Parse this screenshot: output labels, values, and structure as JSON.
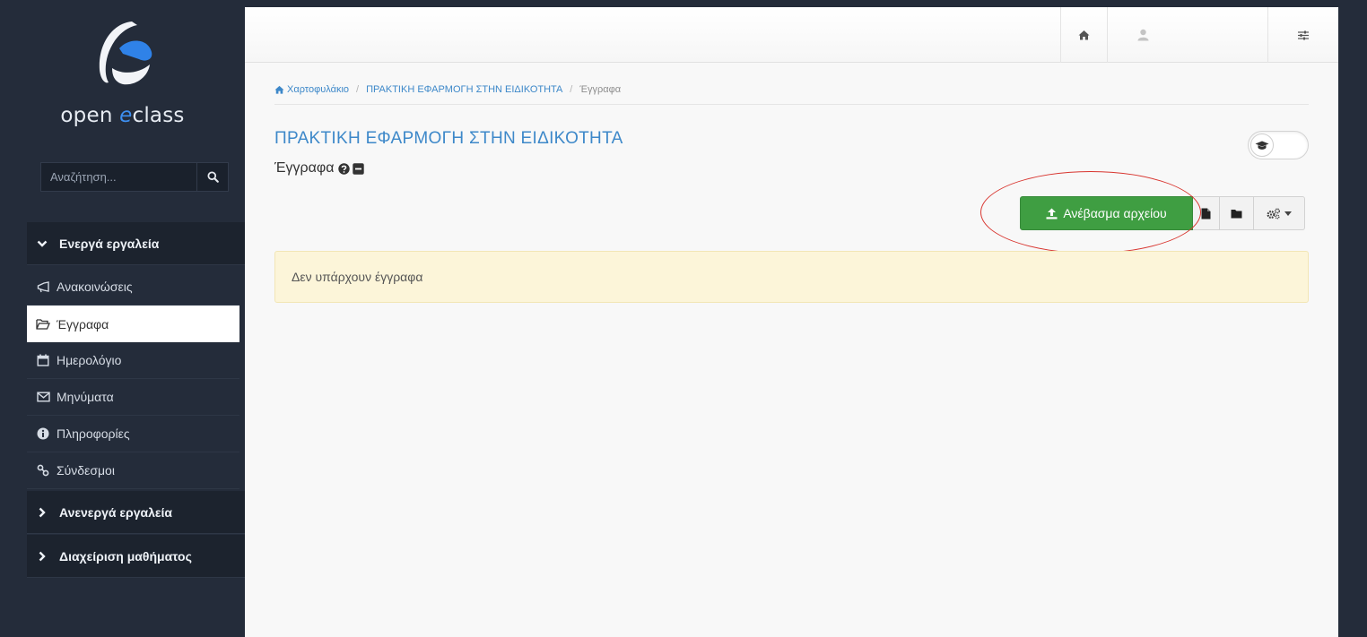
{
  "brand": {
    "name_prefix": "open ",
    "name_accent": "e",
    "name_suffix": "class",
    "accent_color": "#3d8ff0"
  },
  "sidebar": {
    "search": {
      "placeholder": "Αναζήτηση...",
      "value": ""
    },
    "sections": [
      {
        "label": "Ενεργά εργαλεία",
        "expanded": true,
        "icon": "chevron-down-icon"
      },
      {
        "label": "Ανενεργά εργαλεία",
        "expanded": false,
        "icon": "chevron-right-icon"
      },
      {
        "label": "Διαχείριση μαθήματος",
        "expanded": false,
        "icon": "chevron-right-icon"
      }
    ],
    "items": [
      {
        "label": "Ανακοινώσεις",
        "icon": "bullhorn-icon",
        "active": false
      },
      {
        "label": "Έγγραφα",
        "icon": "folder-open-icon",
        "active": true
      },
      {
        "label": "Ημερολόγιο",
        "icon": "calendar-icon",
        "active": false
      },
      {
        "label": "Μηνύματα",
        "icon": "envelope-icon",
        "active": false
      },
      {
        "label": "Πληροφορίες",
        "icon": "info-circle-icon",
        "active": false
      },
      {
        "label": "Σύνδεσμοι",
        "icon": "link-icon",
        "active": false
      }
    ]
  },
  "topbar": {
    "icons": [
      "home-icon",
      "user-icon",
      "sliders-icon"
    ]
  },
  "breadcrumb": {
    "items": [
      "Χαρτοφυλάκιο",
      "ΠΡΑΚΤΙΚΗ ΕΦΑΡΜΟΓΗ ΣΤΗΝ ΕΙΔΙΚΟΤΗΤΑ",
      "Έγγραφα"
    ],
    "separator": "/"
  },
  "page": {
    "course_title": "ΠΡΑΚΤΙΚΗ ΕΦΑΡΜΟΓΗ ΣΤΗΝ ΕΙΔΙΚΟΤΗΤΑ",
    "subtitle": "Έγγραφα",
    "view_toggle_icon": "graduation-cap-icon"
  },
  "actions": {
    "upload_label": "Ανέβασμα αρχείου",
    "upload_color": "#3f9e42",
    "icons": [
      "upload-icon",
      "file-icon",
      "folder-icon",
      "gears-icon",
      "caret-down-icon"
    ]
  },
  "alert": {
    "message": "Δεν υπάρχουν έγγραφα",
    "color": "#fcf5d9"
  },
  "annotation": {
    "ellipse_color": "#d8352f"
  }
}
